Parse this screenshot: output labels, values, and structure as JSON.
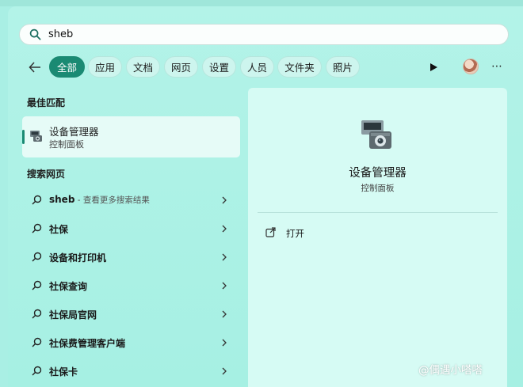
{
  "search": {
    "value": "sheb"
  },
  "filters": {
    "chips": [
      "全部",
      "应用",
      "文档",
      "网页",
      "设置",
      "人员",
      "文件夹",
      "照片"
    ]
  },
  "best_match": {
    "heading": "最佳匹配",
    "title": "设备管理器",
    "subtitle": "控制面板"
  },
  "web_search": {
    "heading": "搜索网页",
    "items": [
      {
        "label": "sheb",
        "hint": " - 查看更多搜索结果"
      },
      {
        "label": "社保",
        "hint": ""
      },
      {
        "label": "设备和打印机",
        "hint": ""
      },
      {
        "label": "社保查询",
        "hint": ""
      },
      {
        "label": "社保局官网",
        "hint": ""
      },
      {
        "label": "社保费管理客户端",
        "hint": ""
      },
      {
        "label": "社保卡",
        "hint": ""
      }
    ]
  },
  "detail": {
    "title": "设备管理器",
    "subtitle": "控制面板",
    "open_label": "打开"
  },
  "watermark": "@偶遇小嗒嗒",
  "colors": {
    "accent": "#1a8a73",
    "background": "#a9efe4"
  }
}
